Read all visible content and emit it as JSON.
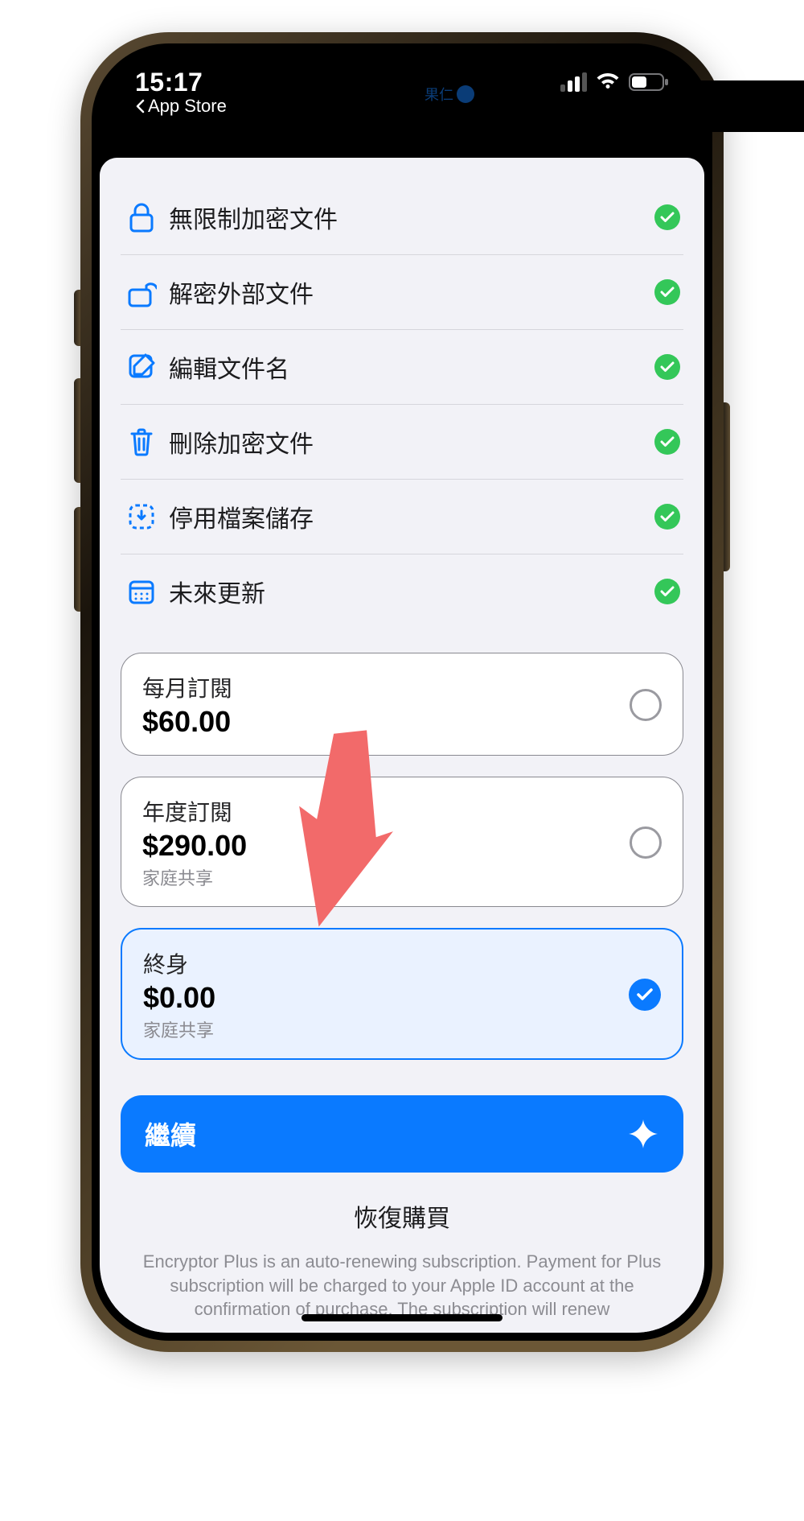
{
  "status": {
    "time": "15:17",
    "back_label": "App Store",
    "island_text": "果仁"
  },
  "features": [
    {
      "icon": "lock-icon",
      "label": "無限制加密文件"
    },
    {
      "icon": "unlock-icon",
      "label": "解密外部文件"
    },
    {
      "icon": "edit-icon",
      "label": "編輯文件名"
    },
    {
      "icon": "trash-icon",
      "label": "刪除加密文件"
    },
    {
      "icon": "save-off-icon",
      "label": "停用檔案儲存"
    },
    {
      "icon": "calendar-icon",
      "label": "未來更新"
    }
  ],
  "plans": [
    {
      "title": "每月訂閱",
      "price": "$60.00",
      "sub": "",
      "selected": false
    },
    {
      "title": "年度訂閱",
      "price": "$290.00",
      "sub": "家庭共享",
      "selected": false
    },
    {
      "title": "終身",
      "price": "$0.00",
      "sub": "家庭共享",
      "selected": true
    }
  ],
  "cta_label": "繼續",
  "restore_label": "恢復購買",
  "fine_print": "Encryptor Plus is an auto-renewing subscription. Payment for Plus subscription will be charged to your Apple ID account at the confirmation of purchase. The subscription will renew",
  "colors": {
    "accent": "#0a7aff",
    "success": "#34c759",
    "selected_bg": "#eaf2ff"
  }
}
